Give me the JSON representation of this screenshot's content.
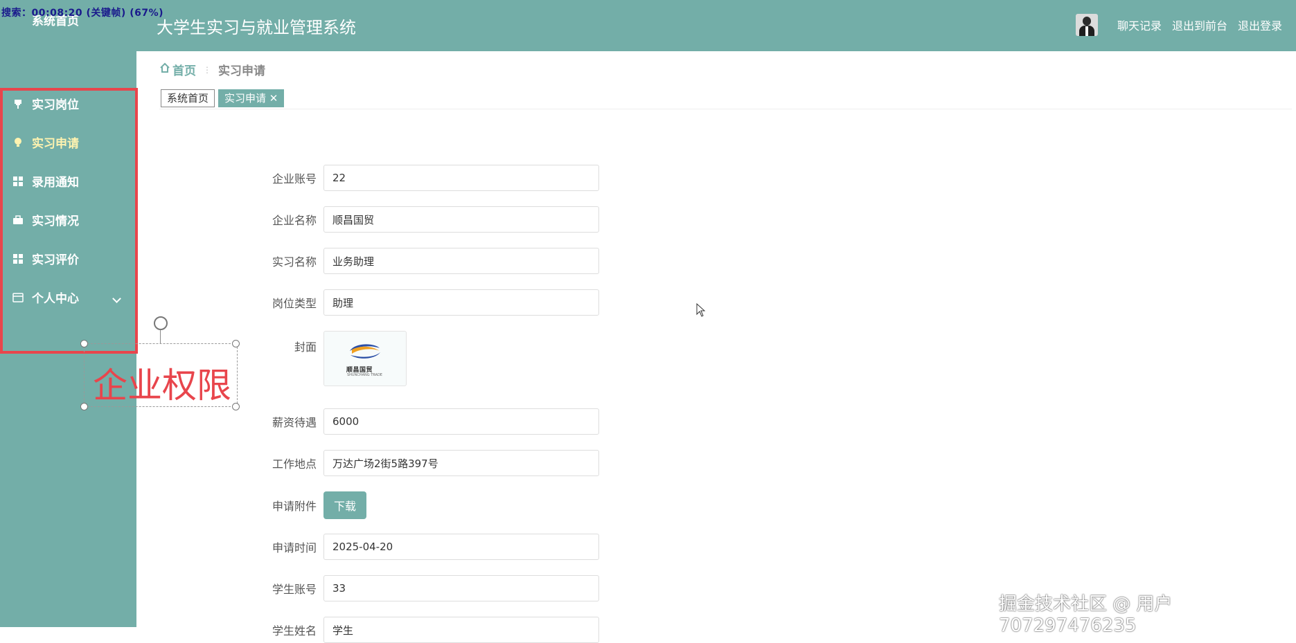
{
  "header": {
    "recording_overlay": "搜索：00:08:20 (关键帧) (67%)",
    "app_title": "大学生实习与就业管理系统",
    "links": [
      "聊天记录",
      "退出到前台",
      "退出登录"
    ]
  },
  "sidebar": {
    "top_item": "系统首页",
    "items": [
      {
        "label": "实习岗位",
        "icon": "pin-icon"
      },
      {
        "label": "实习申请",
        "icon": "lightbulb-icon",
        "active": true
      },
      {
        "label": "录用通知",
        "icon": "grid-icon"
      },
      {
        "label": "实习情况",
        "icon": "briefcase-icon"
      },
      {
        "label": "实习评价",
        "icon": "grid-icon"
      },
      {
        "label": "个人中心",
        "icon": "card-icon",
        "has_submenu": true
      }
    ]
  },
  "annotation": {
    "text": "企业权限"
  },
  "breadcrumb": {
    "home": "首页",
    "current": "实习申请"
  },
  "tabs": [
    {
      "label": "系统首页"
    },
    {
      "label": "实习申请 ✕",
      "active": true
    }
  ],
  "form": {
    "company_account": {
      "label": "企业账号",
      "value": "22"
    },
    "company_name": {
      "label": "企业名称",
      "value": "顺昌国贸"
    },
    "internship_name": {
      "label": "实习名称",
      "value": "业务助理"
    },
    "position_type": {
      "label": "岗位类型",
      "value": "助理"
    },
    "cover": {
      "label": "封面",
      "logo_text": "顺昌国贸",
      "logo_sub": "SHUNCHANG TRADE"
    },
    "salary": {
      "label": "薪资待遇",
      "value": "6000"
    },
    "work_location": {
      "label": "工作地点",
      "value": "万达广场2街5路397号"
    },
    "attachment": {
      "label": "申请附件",
      "button": "下载"
    },
    "apply_time": {
      "label": "申请时间",
      "value": "2025-04-20"
    },
    "student_account": {
      "label": "学生账号",
      "value": "33"
    },
    "student_name": {
      "label": "学生姓名",
      "value": "学生"
    }
  },
  "watermark": "掘金技术社区 @ 用户707297476235",
  "colors": {
    "primary": "#73aea8",
    "highlight_border": "#e8454c",
    "active_menu": "#fff3b0"
  }
}
